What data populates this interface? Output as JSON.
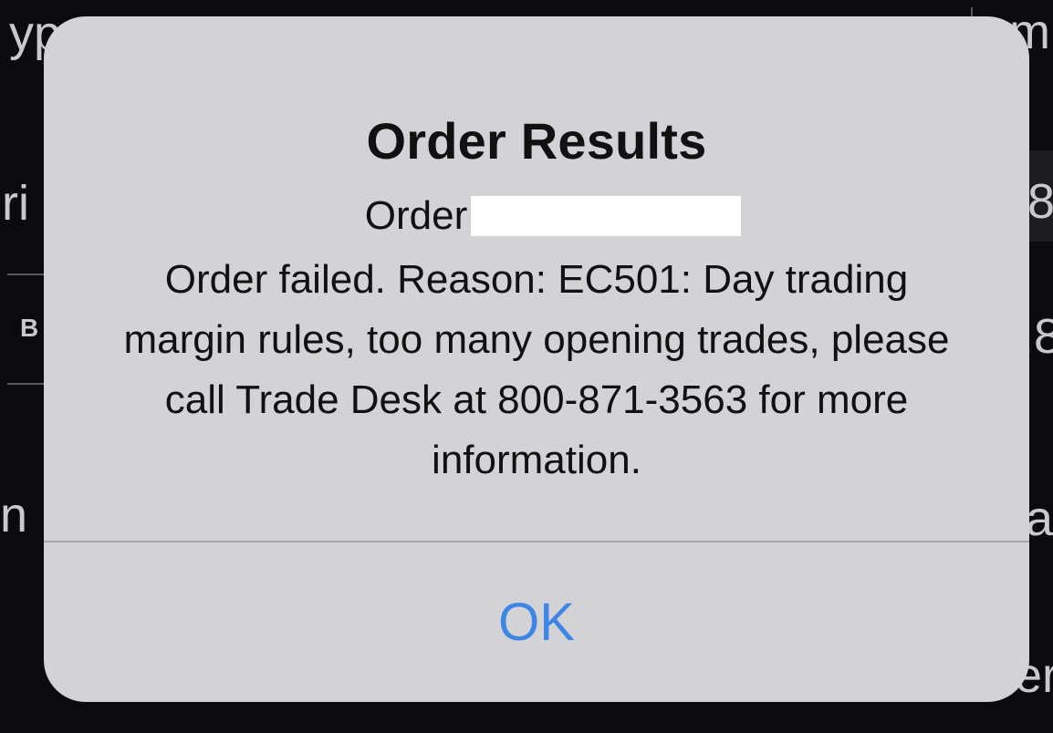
{
  "background": {
    "fragments": [
      "yp",
      "ri",
      "B",
      "n",
      "m",
      "8",
      ".8",
      "a",
      "er"
    ]
  },
  "alert": {
    "title": "Order Results",
    "order_label": "Order",
    "message": "Order failed. Reason: EC501: Day trading margin rules, too many opening trades, please call Trade Desk at 800-871-3563 for more information.",
    "button_label": "OK"
  },
  "colors": {
    "alert_background": "#d3d3d5",
    "button_text": "#3d86e6",
    "redaction": "#ffffff"
  }
}
